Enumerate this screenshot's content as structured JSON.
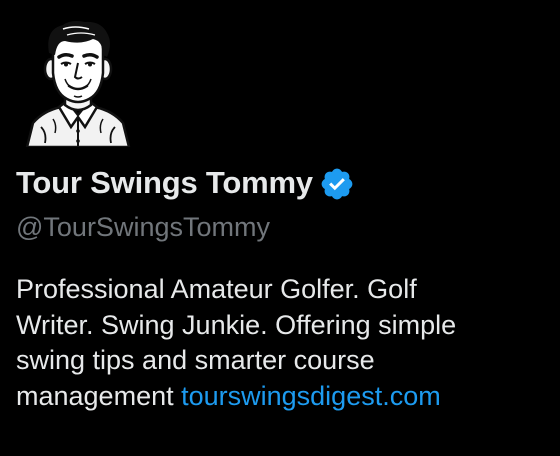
{
  "profile": {
    "display_name": "Tour Swings Tommy",
    "handle": "@TourSwingsTommy",
    "verified_icon": "verified-badge-icon",
    "bio": {
      "line1": "Professional Amateur Golfer. Golf",
      "line2": "Writer. Swing Junkie. Offering simple",
      "line3": "swing tips and smarter course",
      "line4_text": "management ",
      "link": "tourswingsdigest.com"
    }
  },
  "colors": {
    "background": "#000000",
    "primary_text": "#e7e9ea",
    "secondary_text": "#71767b",
    "link": "#1d9bf0",
    "verified_badge": "#1d9bf0"
  }
}
